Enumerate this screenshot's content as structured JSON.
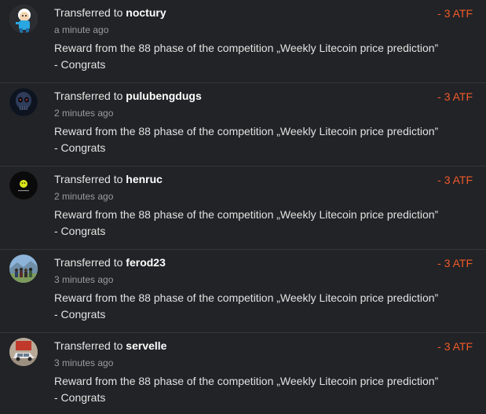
{
  "transactions": [
    {
      "prefix": "Transferred to",
      "user": "noctury",
      "time": "a minute ago",
      "message": "Reward from the 88 phase of the competition „Weekly Litecoin price prediction” - Congrats",
      "amount": "- 3 ATF",
      "avatar_icon": "cartoon-character-avatar"
    },
    {
      "prefix": "Transferred to",
      "user": "pulubengdugs",
      "time": "2 minutes ago",
      "message": "Reward from the 88 phase of the competition „Weekly Litecoin price prediction” - Congrats",
      "amount": "- 3 ATF",
      "avatar_icon": "skull-avatar"
    },
    {
      "prefix": "Transferred to",
      "user": "henruc",
      "time": "2 minutes ago",
      "message": "Reward from the 88 phase of the competition „Weekly Litecoin price prediction” - Congrats",
      "amount": "- 3 ATF",
      "avatar_icon": "yellow-logo-avatar"
    },
    {
      "prefix": "Transferred to",
      "user": "ferod23",
      "time": "3 minutes ago",
      "message": "Reward from the 88 phase of the competition „Weekly Litecoin price prediction” - Congrats",
      "amount": "- 3 ATF",
      "avatar_icon": "group-photo-avatar"
    },
    {
      "prefix": "Transferred to",
      "user": "servelle",
      "time": "3 minutes ago",
      "message": "Reward from the 88 phase of the competition „Weekly Litecoin price prediction” - Congrats",
      "amount": "- 3 ATF",
      "avatar_icon": "car-photo-avatar"
    }
  ],
  "colors": {
    "background": "#222326",
    "amount": "#f15a2b",
    "divider": "#34363b"
  }
}
